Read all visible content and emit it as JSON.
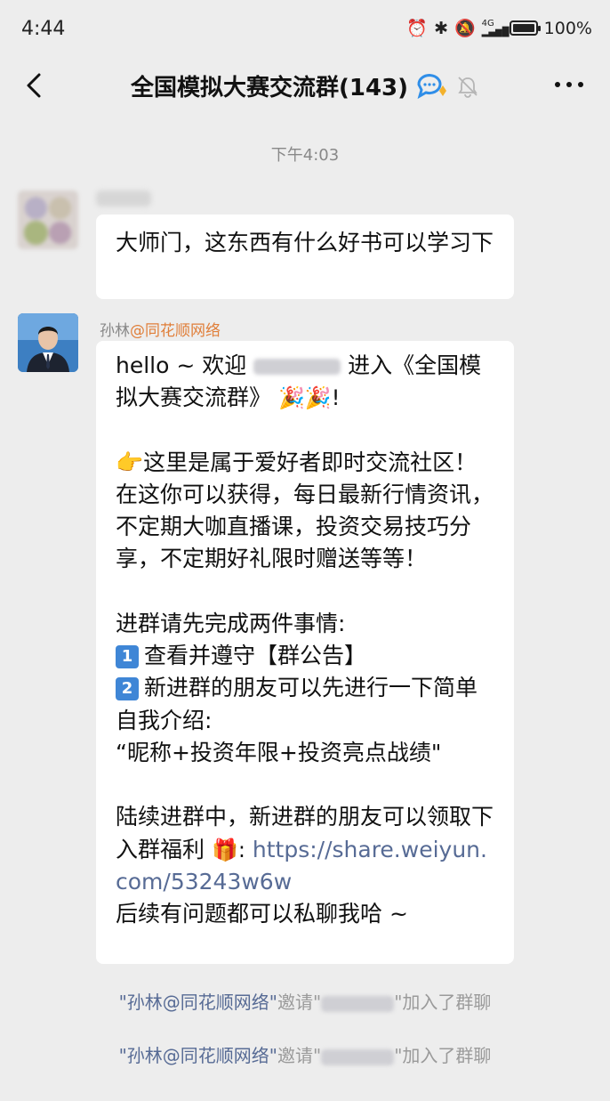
{
  "status_bar": {
    "time": "4:44",
    "network": "4G",
    "battery": "100%"
  },
  "nav": {
    "title": "全国模拟大赛交流群(143)"
  },
  "chat": {
    "timestamp": "下午4:03",
    "messages": [
      {
        "text": "大师门，这东西有什么好书可以学习下"
      },
      {
        "sender_name": "孙林",
        "sender_org": "@同花顺网络",
        "lines": [
          "hello ~ 欢迎",
          "进入《全国模拟大赛交流群》",
          "🎉🎉!",
          "👉这里是属于爱好者即时交流社区！在这你可以获得，每日最新行情资讯，不定期大咖直播课，投资交易技巧分享，不定期好礼限时赠送等等！",
          "进群请先完成两件事情:",
          "1",
          "查看并遵守【群公告】",
          "2",
          "新进群的朋友可以先进行一下简单自我介绍:",
          "“昵称+投资年限+投资亮点战绩\"",
          "陆续进群中，新进群的朋友可以领取下入群福利",
          "🎁:",
          "https://share.weiyun.com/53243w6w",
          "后续有问题都可以私聊我哈 ~"
        ]
      }
    ],
    "system_messages": [
      {
        "inviter": "\"孙林@同花顺网络\"",
        "invite": "邀请\"",
        "joined": "\"加入了群聊"
      },
      {
        "inviter": "\"孙林@同花顺网络\"",
        "invite": "邀请\"",
        "joined": "\"加入了群聊"
      }
    ]
  }
}
